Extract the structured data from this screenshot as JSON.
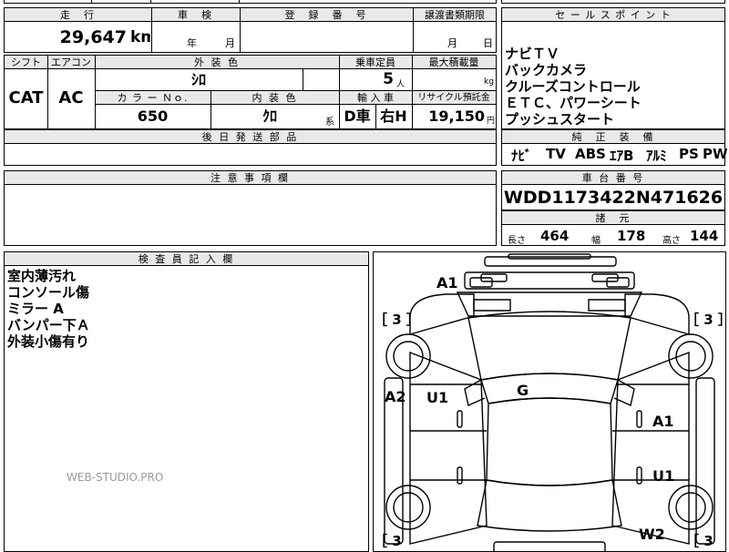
{
  "top_row": {
    "mileage_header": "走　行",
    "inspection_header": "車　検",
    "registration_header": "登　録　番　号",
    "transfer_header": "譲渡書類期限",
    "mileage_value": "29,647",
    "mileage_unit": "km",
    "inspection_year_label": "年",
    "inspection_month_label": "月",
    "transfer_month_label": "月",
    "transfer_day_label": "日"
  },
  "spec_row": {
    "shift_header": "シフト",
    "aircon_header": "エアコン",
    "exterior_color_header": "外 装 色",
    "capacity_header": "乗車定員",
    "max_load_header": "最大積載量",
    "shift_value": "CAT",
    "aircon_value": "AC",
    "exterior_color_value": "ｼﾛ",
    "capacity_value": "5",
    "capacity_unit": "人",
    "max_load_unit": "kg",
    "color_no_header": "カ ラ ー Ｎｏ.",
    "interior_color_header": "内 装 色",
    "import_header": "輸 入 車",
    "recycle_header": "リサイクル預託金",
    "color_no_value": "650",
    "interior_color_value": "ｸﾛ",
    "interior_color_suffix": "系",
    "import_value_1": "D車",
    "import_value_2": "右H",
    "recycle_value": "19,150",
    "recycle_unit": "円"
  },
  "later_parts": {
    "header": "後 日 発 送 部 品"
  },
  "sales_points": {
    "header": "セ ー ル ス ポ イ ン ト",
    "items": [
      "ナビＴＶ",
      "バックカメラ",
      "クルーズコントロール",
      "ＥＴＣ、パワーシート",
      "プッシュスタート"
    ]
  },
  "equipment": {
    "header": "純　正　装　備",
    "items": [
      "ﾅﾋﾞ",
      "TV",
      "ABS",
      "ｴｱB",
      "ｱﾙﾐ",
      "PS",
      "PW"
    ]
  },
  "notes": {
    "header": "注 意 事 項 欄"
  },
  "chassis": {
    "header": "車 台 番 号",
    "value": "WDD1173422N471626"
  },
  "dimensions": {
    "header": "諸　元",
    "length_label": "長さ",
    "length_value": "464",
    "width_label": "幅",
    "width_value": "178",
    "height_label": "高さ",
    "height_value": "144"
  },
  "inspector": {
    "header": "検 査 員 記 入 欄",
    "lines": [
      "室内薄汚れ",
      "コンソール傷",
      "ミラー A",
      "バンパー下Ａ",
      "外装小傷有り"
    ]
  },
  "watermark": "WEB-STUDIO.PRO",
  "diagram": {
    "marks": {
      "a1_top": "A1",
      "g": "G",
      "a2": "A2",
      "u1_left": "U1",
      "a1_right": "A1",
      "u1_right": "U1",
      "w2": "W2"
    },
    "tires": {
      "front_left": "［ 3 ］",
      "front_right": "［ 3 ］",
      "rear_left": "［ 3",
      "rear_right": "［ 3"
    }
  }
}
